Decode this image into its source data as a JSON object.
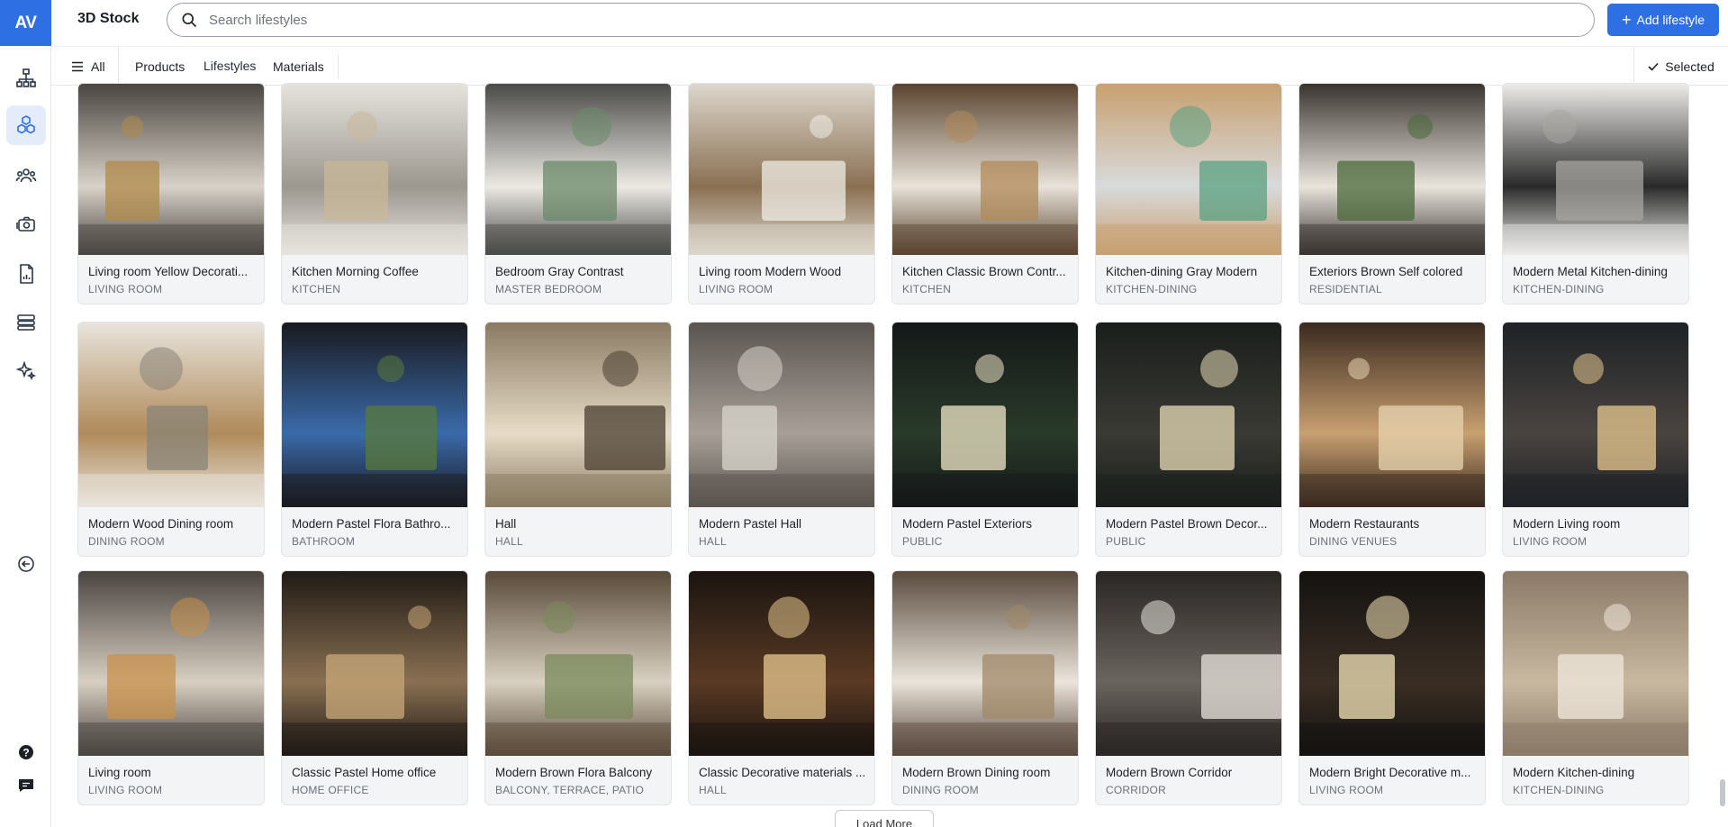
{
  "sidebar": {
    "logo": "AV",
    "nav": [
      {
        "icon": "hierarchy-icon"
      },
      {
        "icon": "cubes-icon",
        "active": true
      },
      {
        "icon": "users-icon"
      },
      {
        "icon": "camera-icon"
      },
      {
        "icon": "report-icon"
      },
      {
        "icon": "database-icon"
      },
      {
        "icon": "sparkle-icon"
      }
    ],
    "bottom": [
      {
        "icon": "collapse-icon"
      },
      {
        "icon": "help-icon"
      },
      {
        "icon": "chat-icon"
      }
    ]
  },
  "header": {
    "title": "3D Stock",
    "search_placeholder": "Search lifestyles",
    "add_button": "Add lifestyle"
  },
  "tabs": {
    "all": "All",
    "items": [
      {
        "label": "Products"
      },
      {
        "label": "Lifestyles",
        "active": true
      },
      {
        "label": "Materials"
      }
    ],
    "selected": "Selected"
  },
  "cards": [
    {
      "title": "Living room Yellow Decorati...",
      "category": "LIVING ROOM",
      "palette": [
        "#4a4540",
        "#d8d2c8",
        "#b08a4a"
      ]
    },
    {
      "title": "Kitchen Morning Coffee",
      "category": "KITCHEN",
      "palette": [
        "#e6e3dd",
        "#9c9890",
        "#c8b89a"
      ]
    },
    {
      "title": "Bedroom Gray Contrast",
      "category": "MASTER BEDROOM",
      "palette": [
        "#4a4a48",
        "#ece9e3",
        "#6a8a6a"
      ]
    },
    {
      "title": "Living room Modern Wood",
      "category": "LIVING ROOM",
      "palette": [
        "#dcd6cc",
        "#8a7052",
        "#f0ece6"
      ]
    },
    {
      "title": "Kitchen Classic Brown Contr...",
      "category": "KITCHEN",
      "palette": [
        "#5a4430",
        "#e8e2d8",
        "#b08a5a"
      ]
    },
    {
      "title": "Kitchen-dining Gray Modern",
      "category": "KITCHEN-DINING",
      "palette": [
        "#c8a070",
        "#d8dadc",
        "#5aa080"
      ]
    },
    {
      "title": "Exteriors Brown Self colored",
      "category": "RESIDENTIAL",
      "palette": [
        "#3a3430",
        "#e8e4dc",
        "#4a6a3a"
      ]
    },
    {
      "title": "Modern Metal Kitchen-dining",
      "category": "KITCHEN-DINING",
      "palette": [
        "#ecebe8",
        "#2a2a2a",
        "#a8a6a2"
      ]
    },
    {
      "title": "Modern Wood Dining room",
      "category": "DINING ROOM",
      "palette": [
        "#e8e4dc",
        "#b08a5a",
        "#8a8478"
      ]
    },
    {
      "title": "Modern Pastel Flora Bathro...",
      "category": "BATHROOM",
      "palette": [
        "#1a1a1e",
        "#3a6aaa",
        "#5a7a3a"
      ]
    },
    {
      "title": "Hall",
      "category": "HALL",
      "palette": [
        "#8a7a62",
        "#e8dcc8",
        "#4a3e30"
      ]
    },
    {
      "title": "Modern Pastel Hall",
      "category": "HALL",
      "palette": [
        "#5a5450",
        "#a8a098",
        "#d8d4cc"
      ]
    },
    {
      "title": "Modern Pastel Exteriors",
      "category": "PUBLIC",
      "palette": [
        "#141818",
        "#2a3a2a",
        "#f0e8c8"
      ]
    },
    {
      "title": "Modern Pastel Brown Decor...",
      "category": "PUBLIC",
      "palette": [
        "#1a1e1c",
        "#3a3a34",
        "#e8dcb8"
      ]
    },
    {
      "title": "Modern Restaurants",
      "category": "DINING VENUES",
      "palette": [
        "#3a2a20",
        "#c8a070",
        "#e8d4b0"
      ]
    },
    {
      "title": "Modern Living room",
      "category": "LIVING ROOM",
      "palette": [
        "#1e2226",
        "#4a4440",
        "#e8c890"
      ]
    },
    {
      "title": "Living room",
      "category": "LIVING ROOM",
      "palette": [
        "#4a4440",
        "#d8cfc2",
        "#c8904a"
      ]
    },
    {
      "title": "Classic Pastel Home office",
      "category": "HOME OFFICE",
      "palette": [
        "#201a16",
        "#8a7052",
        "#c8a878"
      ]
    },
    {
      "title": "Modern Brown Flora Balcony",
      "category": "BALCONY, TERRACE, PATIO",
      "palette": [
        "#5a4a3a",
        "#d8d0c0",
        "#7a8a5a"
      ]
    },
    {
      "title": "Classic Decorative materials ...",
      "category": "HALL",
      "palette": [
        "#1a1410",
        "#5a3a24",
        "#e8c890"
      ]
    },
    {
      "title": "Modern Brown Dining room",
      "category": "DINING ROOM",
      "palette": [
        "#5a4a3e",
        "#eae4da",
        "#a08868"
      ]
    },
    {
      "title": "Modern Brown Corridor",
      "category": "CORRIDOR",
      "palette": [
        "#2a2624",
        "#6a645e",
        "#e8e4dc"
      ]
    },
    {
      "title": "Modern Bright Decorative m...",
      "category": "LIVING ROOM",
      "palette": [
        "#141210",
        "#3a2e24",
        "#f4e4b8"
      ]
    },
    {
      "title": "Modern Kitchen-dining",
      "category": "KITCHEN-DINING",
      "palette": [
        "#8a7a68",
        "#c8b8a0",
        "#f0e8dc"
      ]
    }
  ],
  "load_more": "Load More",
  "colors": {
    "accent": "#2f6fe4",
    "active_bg": "#e4ecfb"
  }
}
